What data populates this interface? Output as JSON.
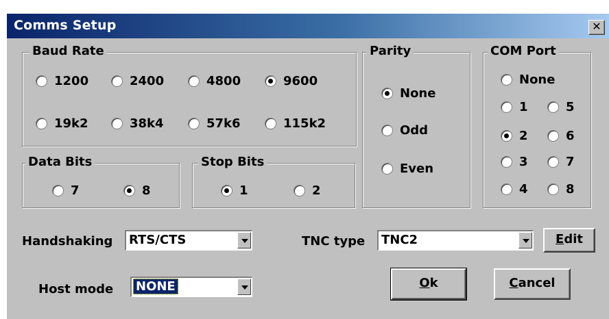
{
  "window": {
    "title": "Comms Setup",
    "close_glyph": "✕"
  },
  "baud_rate": {
    "label": "Baud Rate",
    "options": [
      {
        "label": "1200",
        "checked": false
      },
      {
        "label": "2400",
        "checked": false
      },
      {
        "label": "4800",
        "checked": false
      },
      {
        "label": "9600",
        "checked": true
      },
      {
        "label": "19k2",
        "checked": false
      },
      {
        "label": "38k4",
        "checked": false
      },
      {
        "label": "57k6",
        "checked": false
      },
      {
        "label": "115k2",
        "checked": false
      }
    ]
  },
  "parity": {
    "label": "Parity",
    "options": [
      {
        "label": "None",
        "checked": true
      },
      {
        "label": "Odd",
        "checked": false
      },
      {
        "label": "Even",
        "checked": false
      }
    ]
  },
  "com_port": {
    "label": "COM Port",
    "options": [
      {
        "label": "None",
        "checked": false
      },
      {
        "label": "1",
        "checked": false
      },
      {
        "label": "5",
        "checked": false
      },
      {
        "label": "2",
        "checked": true
      },
      {
        "label": "6",
        "checked": false
      },
      {
        "label": "3",
        "checked": false
      },
      {
        "label": "7",
        "checked": false
      },
      {
        "label": "4",
        "checked": false
      },
      {
        "label": "8",
        "checked": false
      }
    ]
  },
  "data_bits": {
    "label": "Data Bits",
    "options": [
      {
        "label": "7",
        "checked": false
      },
      {
        "label": "8",
        "checked": true
      }
    ]
  },
  "stop_bits": {
    "label": "Stop Bits",
    "options": [
      {
        "label": "1",
        "checked": true
      },
      {
        "label": "2",
        "checked": false
      }
    ]
  },
  "handshaking": {
    "label": "Handshaking",
    "value": "RTS/CTS"
  },
  "tnc_type": {
    "label": "TNC type",
    "value": "TNC2"
  },
  "host_mode": {
    "label": "Host mode",
    "value": "NONE"
  },
  "buttons": {
    "edit_accel": "E",
    "edit_rest": "dit",
    "ok_accel": "O",
    "ok_rest": "k",
    "cancel_accel": "C",
    "cancel_rest": "ancel"
  }
}
